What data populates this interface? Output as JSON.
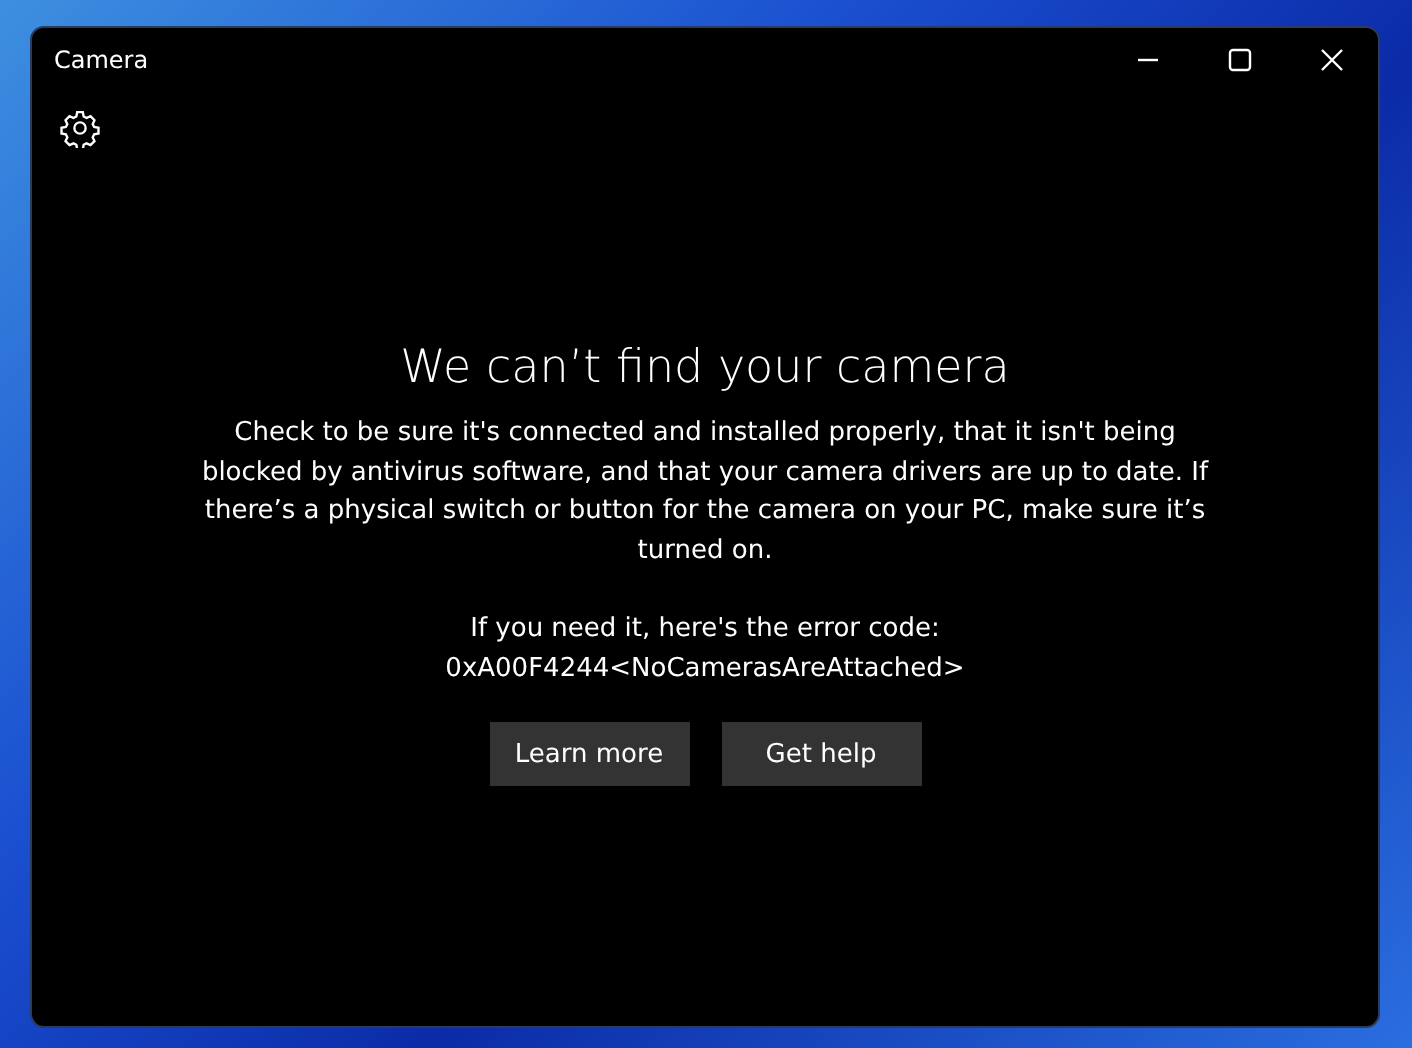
{
  "window": {
    "title": "Camera",
    "controls": [
      {
        "kind": "minimize"
      },
      {
        "kind": "maximize"
      },
      {
        "kind": "close"
      }
    ]
  },
  "error": {
    "heading": "We can’t find your camera",
    "message": "Check to be sure it's connected and installed properly, that it isn't being blocked by antivirus software, and that your camera drivers are up to date. If there’s a physical switch or button for the camera on your PC, make sure it’s turned on.",
    "code_prompt": "If you need it, here's the error code:",
    "code": "0xA00F4244<NoCamerasAreAttached>"
  },
  "buttons": [
    "Learn more",
    "Get help"
  ]
}
